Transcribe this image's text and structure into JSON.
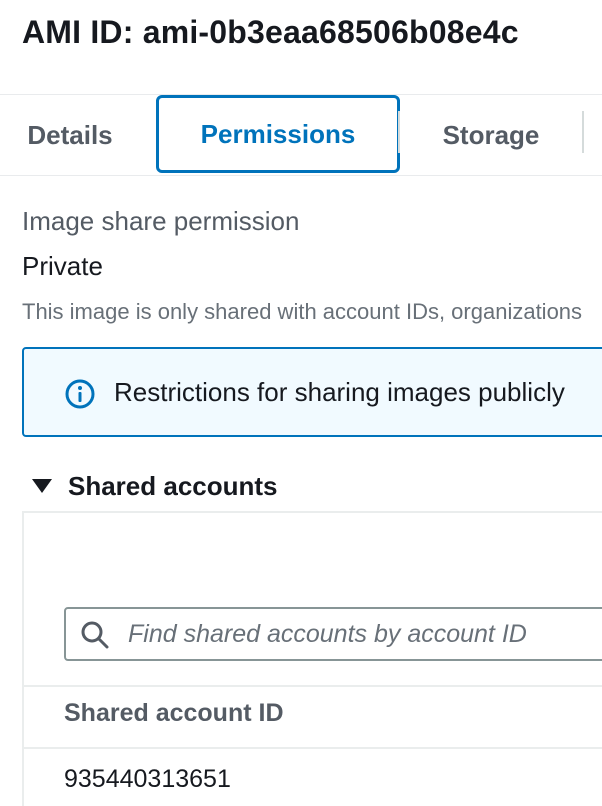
{
  "header": {
    "title": "AMI ID: ami-0b3eaa68506b08e4c"
  },
  "tabs": [
    {
      "label": "Details",
      "selected": false
    },
    {
      "label": "Permissions",
      "selected": true
    },
    {
      "label": "Storage",
      "selected": false
    }
  ],
  "permissions": {
    "share_label": "Image share permission",
    "share_value": "Private",
    "description": "This image is only shared with account IDs, organizations"
  },
  "alert": {
    "icon": "info-icon",
    "text": "Restrictions for sharing images publicly"
  },
  "shared_accounts": {
    "title": "Shared accounts",
    "expanded": true,
    "search": {
      "placeholder": "Find shared accounts by account ID",
      "value": ""
    },
    "columns": [
      "Shared account ID"
    ],
    "rows": [
      [
        "935440313651"
      ]
    ]
  },
  "colors": {
    "accent": "#0073bb",
    "alert_bg": "#f1faff",
    "text": "#16191f",
    "secondary_text": "#545b64"
  }
}
